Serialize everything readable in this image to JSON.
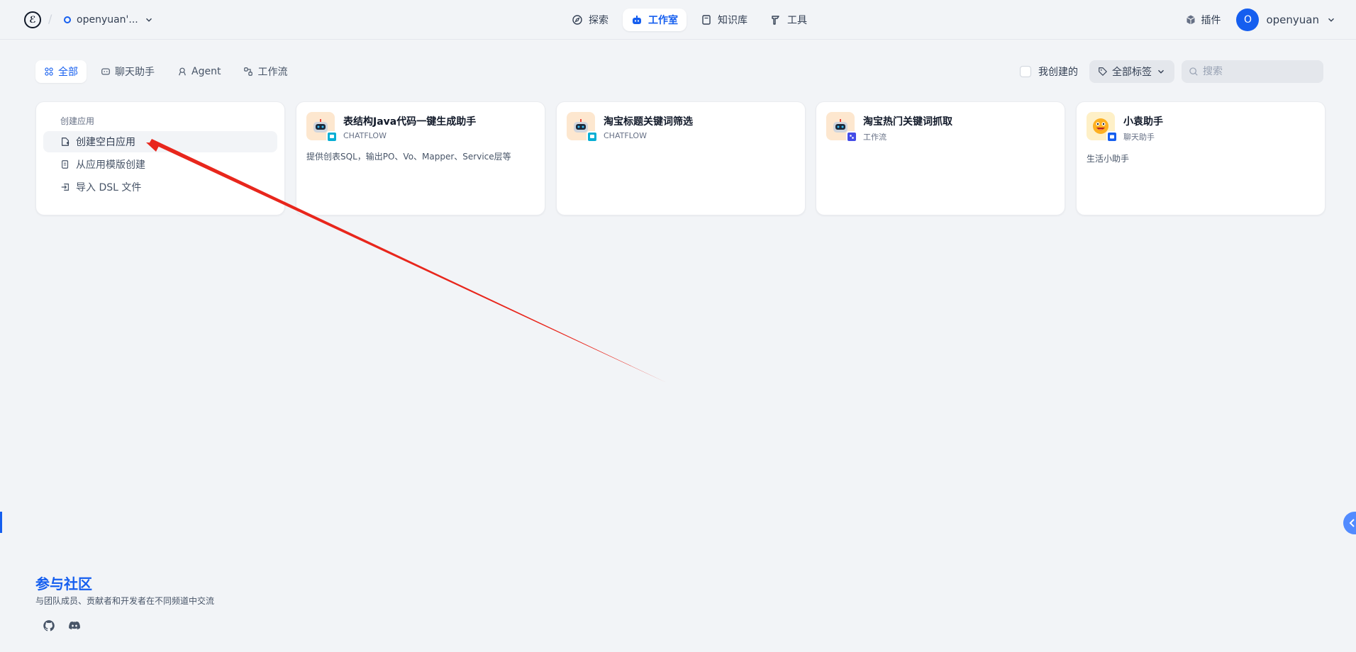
{
  "header": {
    "workspace_name": "openyuan'...",
    "nav": [
      {
        "label": "探索"
      },
      {
        "label": "工作室"
      },
      {
        "label": "知识库"
      },
      {
        "label": "工具"
      }
    ],
    "plugin_label": "插件",
    "user_initial": "O",
    "user_name": "openyuan"
  },
  "filters": {
    "tabs": [
      {
        "label": "全部"
      },
      {
        "label": "聊天助手"
      },
      {
        "label": "Agent"
      },
      {
        "label": "工作流"
      }
    ],
    "created_by_me": "我创建的",
    "tag_select": "全部标签",
    "search_placeholder": "搜索"
  },
  "create_panel": {
    "title": "创建应用",
    "items": [
      {
        "label": "创建空白应用"
      },
      {
        "label": "从应用模版创建"
      },
      {
        "label": "导入 DSL 文件"
      }
    ]
  },
  "apps": [
    {
      "name": "表结构Java代码一键生成助手",
      "type": "CHATFLOW",
      "desc": "提供创表SQL，输出PO、Vo、Mapper、Service层等"
    },
    {
      "name": "淘宝标题关键词筛选",
      "type": "CHATFLOW",
      "desc": ""
    },
    {
      "name": "淘宝热门关键词抓取",
      "type": "工作流",
      "desc": ""
    },
    {
      "name": "小袁助手",
      "type": "聊天助手",
      "desc": "生活小助手"
    }
  ],
  "community": {
    "title": "参与社区",
    "subtitle": "与团队成员、贡献者和开发者在不同频道中交流"
  },
  "colors": {
    "accent": "#155eef",
    "background": "#f2f4f7",
    "annotation_arrow": "#e8261c"
  }
}
